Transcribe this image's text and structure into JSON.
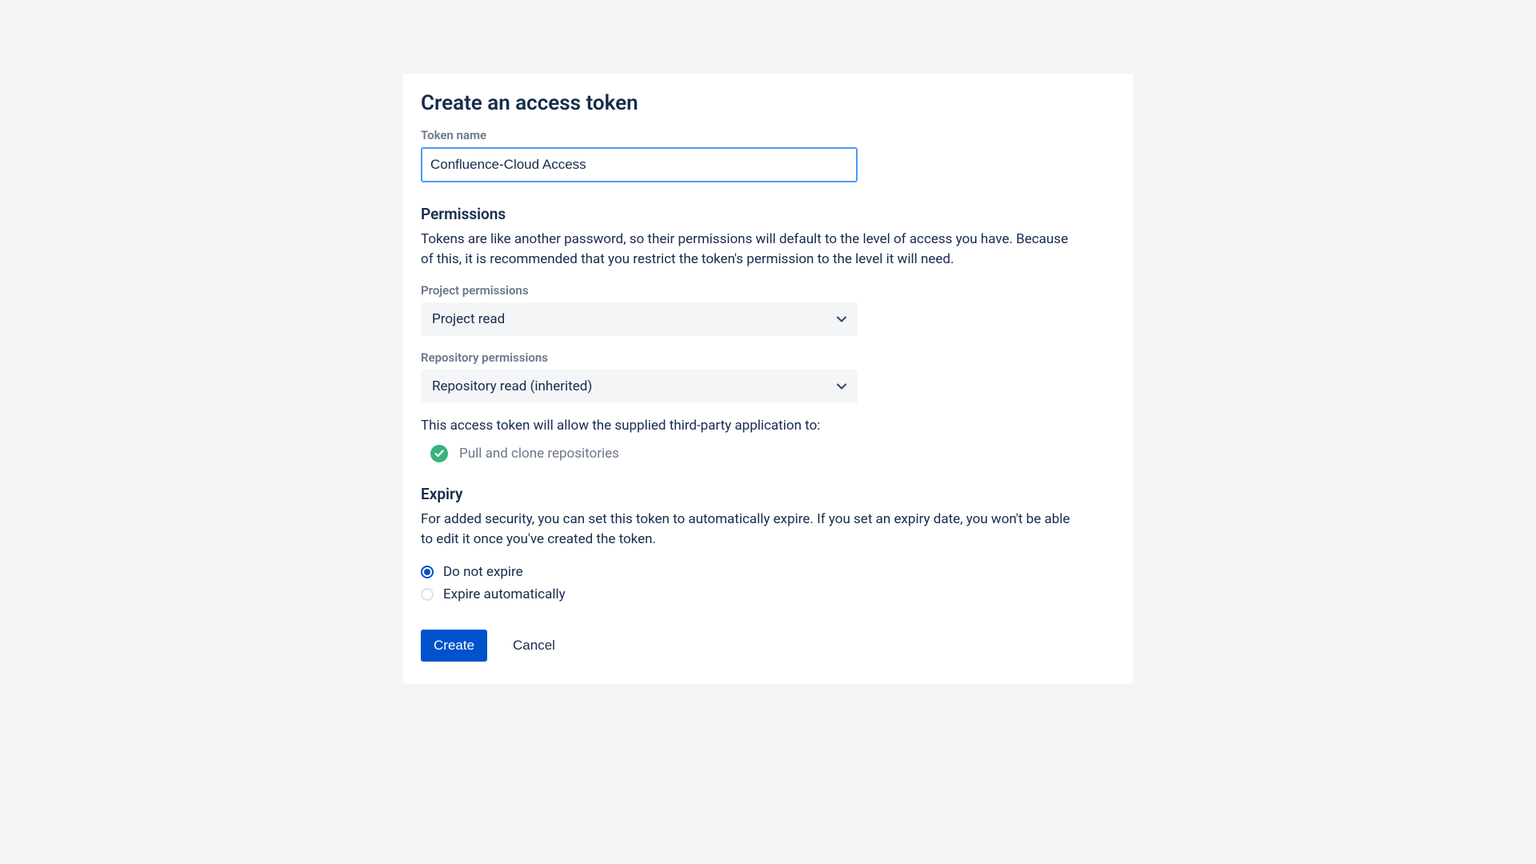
{
  "title": "Create an access token",
  "token_name": {
    "label": "Token name",
    "value": "Confluence-Cloud Access"
  },
  "permissions": {
    "heading": "Permissions",
    "description": "Tokens are like another password, so their permissions will default to the level of access you have. Because of this, it is recommended that you restrict the token's permission to the level it will need.",
    "project": {
      "label": "Project permissions",
      "value": "Project read"
    },
    "repository": {
      "label": "Repository permissions",
      "value": "Repository read (inherited)"
    },
    "allow_text": "This access token will allow the supplied third-party application to:",
    "allow_item": "Pull and clone repositories"
  },
  "expiry": {
    "heading": "Expiry",
    "description": "For added security, you can set this token to automatically expire. If you set an expiry date, you won't be able to edit it once you've created the token.",
    "option_no_expire": "Do not expire",
    "option_auto_expire": "Expire automatically"
  },
  "buttons": {
    "create": "Create",
    "cancel": "Cancel"
  }
}
